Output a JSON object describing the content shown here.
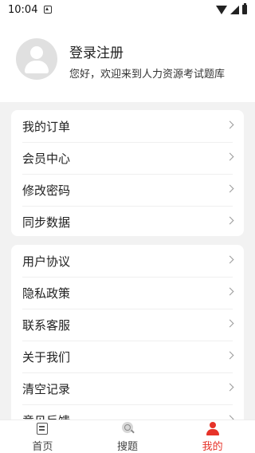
{
  "status_bar": {
    "time": "10:04"
  },
  "profile": {
    "login_label": "登录注册",
    "welcome_text": "您好，欢迎来到人力资源考试题库"
  },
  "menu_group_1": [
    {
      "label": "我的订单"
    },
    {
      "label": "会员中心"
    },
    {
      "label": "修改密码"
    },
    {
      "label": "同步数据"
    }
  ],
  "menu_group_2": [
    {
      "label": "用户协议"
    },
    {
      "label": "隐私政策"
    },
    {
      "label": "联系客服"
    },
    {
      "label": "关于我们"
    },
    {
      "label": "清空记录"
    },
    {
      "label": "意见反馈"
    }
  ],
  "tabbar": {
    "tabs": [
      {
        "label": "首页",
        "icon": "home-icon",
        "active": false
      },
      {
        "label": "搜题",
        "icon": "search-icon",
        "active": false
      },
      {
        "label": "我的",
        "icon": "user-icon",
        "active": true
      }
    ],
    "active_color": "#e63329"
  }
}
